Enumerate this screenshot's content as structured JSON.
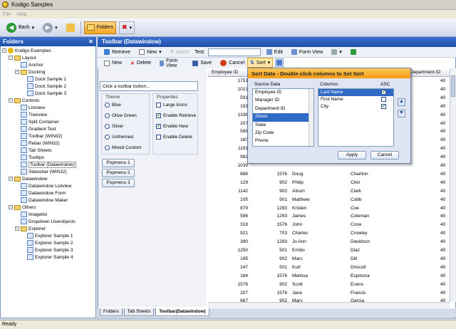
{
  "window": {
    "title": "Kodigo Samples"
  },
  "menu": [
    "File",
    "Help"
  ],
  "toolbar": {
    "back": "Back",
    "folders": "Folders"
  },
  "left": {
    "title": "Folders",
    "tree": [
      {
        "label": "Kodigo Examples",
        "depth": 0,
        "type": "root"
      },
      {
        "label": "Layout",
        "depth": 1,
        "type": "folder"
      },
      {
        "label": "Anchor",
        "depth": 2,
        "type": "doc"
      },
      {
        "label": "Docking",
        "depth": 2,
        "type": "folder"
      },
      {
        "label": "Dock Sample 1",
        "depth": 3,
        "type": "doc"
      },
      {
        "label": "Dock Sample 2",
        "depth": 3,
        "type": "doc"
      },
      {
        "label": "Dock Sample 3",
        "depth": 3,
        "type": "doc"
      },
      {
        "label": "Controls",
        "depth": 1,
        "type": "folder"
      },
      {
        "label": "Listview",
        "depth": 2,
        "type": "doc"
      },
      {
        "label": "Treeview",
        "depth": 2,
        "type": "doc"
      },
      {
        "label": "Split Container",
        "depth": 2,
        "type": "doc"
      },
      {
        "label": "Gradient Text",
        "depth": 2,
        "type": "doc"
      },
      {
        "label": "Toolbar (WIN32)",
        "depth": 2,
        "type": "doc"
      },
      {
        "label": "Rebar (WIN32)",
        "depth": 2,
        "type": "doc"
      },
      {
        "label": "Tab Sheets",
        "depth": 2,
        "type": "doc"
      },
      {
        "label": "Tooltips",
        "depth": 2,
        "type": "doc"
      },
      {
        "label": "Toolbar (Datawindow)",
        "depth": 2,
        "type": "doc",
        "selected": true
      },
      {
        "label": "Statusbar (WIN32)",
        "depth": 2,
        "type": "doc"
      },
      {
        "label": "Datawindow",
        "depth": 1,
        "type": "folder"
      },
      {
        "label": "Datawindow Listview",
        "depth": 2,
        "type": "doc"
      },
      {
        "label": "Datawindow Form",
        "depth": 2,
        "type": "doc"
      },
      {
        "label": "Datawindow Maker",
        "depth": 2,
        "type": "doc"
      },
      {
        "label": "Others",
        "depth": 1,
        "type": "folder"
      },
      {
        "label": "Imagelist",
        "depth": 2,
        "type": "doc"
      },
      {
        "label": "Dropdown Userobjects",
        "depth": 2,
        "type": "doc"
      },
      {
        "label": "Explorer",
        "depth": 2,
        "type": "folder"
      },
      {
        "label": "Explorer Sample 1",
        "depth": 3,
        "type": "doc"
      },
      {
        "label": "Explorer Sample 2",
        "depth": 3,
        "type": "doc"
      },
      {
        "label": "Explorer Sample 3",
        "depth": 3,
        "type": "doc"
      },
      {
        "label": "Explorer Sample 4",
        "depth": 3,
        "type": "doc"
      }
    ]
  },
  "right": {
    "title": "Toolbar (Datawindow)"
  },
  "tb1": {
    "retrieve": "Retrieve",
    "new": "New",
    "insert": "Insert",
    "test": "Test:",
    "edit": "Edit",
    "formview": "Form View"
  },
  "tb2": {
    "new": "New",
    "delete": "Delete",
    "formview": "Form View",
    "save": "Save",
    "cancel": "Cancel",
    "sort": "Sort"
  },
  "form": {
    "placeholder": "Click a toolbar button...",
    "theme": {
      "title": "Theme",
      "options": [
        "Blue",
        "Olive Green",
        "Silver",
        "Unthemed",
        "Mixed Custom"
      ]
    },
    "props": {
      "title": "Properties",
      "options": [
        {
          "label": "Large Icons",
          "checked": false
        },
        {
          "label": "Enable Retrieve",
          "checked": true
        },
        {
          "label": "Enable New",
          "checked": true
        },
        {
          "label": "Enable Delete",
          "checked": false
        }
      ]
    },
    "popmenus": [
      "Popmenu 1",
      "Popmenu 2",
      "Popmenu 3"
    ]
  },
  "grid": {
    "headers": [
      "Employee ID",
      "Department ID"
    ],
    "rows": [
      [
        "1751",
        "",
        "",
        "",
        "40"
      ],
      [
        "1013",
        "",
        "",
        "",
        "40"
      ],
      [
        "591",
        "",
        "",
        "",
        "40"
      ],
      [
        "191",
        "",
        "",
        "",
        "40"
      ],
      [
        "1336",
        "",
        "",
        "",
        "40"
      ],
      [
        "207",
        "",
        "",
        "",
        "40"
      ],
      [
        "568",
        "",
        "",
        "",
        "40"
      ],
      [
        "160",
        "",
        "",
        "",
        "40"
      ],
      [
        "1191",
        "",
        "",
        "",
        "40"
      ],
      [
        "992",
        "",
        "",
        "",
        "40"
      ],
      [
        "1039",
        "",
        "",
        "",
        "40"
      ],
      [
        "888",
        "1576",
        "Doug",
        "Charlton",
        "40"
      ],
      [
        "129",
        "902",
        "Philip",
        "Chin",
        "40"
      ],
      [
        "1142",
        "902",
        "Alison",
        "Clark",
        "40"
      ],
      [
        "105",
        "501",
        "Matthew",
        "Cobb",
        "40"
      ],
      [
        "879",
        "1293",
        "Kristen",
        "Coe",
        "40"
      ],
      [
        "586",
        "1293",
        "James",
        "Coleman",
        "40"
      ],
      [
        "318",
        "1576",
        "John",
        "Crow",
        "40"
      ],
      [
        "921",
        "703",
        "Charles",
        "Crowley",
        "40"
      ],
      [
        "390",
        "1293",
        "Jo Ann",
        "Davidson",
        "40"
      ],
      [
        "1250",
        "501",
        "Emilio",
        "Diaz",
        "40"
      ],
      [
        "195",
        "902",
        "Marc",
        "Dill",
        "40"
      ],
      [
        "247",
        "501",
        "Kurt",
        "Driscoll",
        "40"
      ],
      [
        "184",
        "1576",
        "Melissa",
        "Espinoza",
        "40"
      ],
      [
        "1576",
        "902",
        "Scott",
        "Evans",
        "40"
      ],
      [
        "207",
        "1576",
        "Jane",
        "Francis",
        "40"
      ],
      [
        "667",
        "902",
        "Mary",
        "Garcia",
        "40"
      ]
    ]
  },
  "tabs": [
    "Folders",
    "Tab Sheets",
    "Toolbar(Datawindow)"
  ],
  "status": "Ready",
  "sort": {
    "title": "Sort Data - Double-click columns to Set Sort",
    "source_label": "Source Data",
    "columns_label": "Columns",
    "asc_label": "ASC",
    "source": [
      "Employee ID",
      "Manager ID",
      "Department ID",
      "Street",
      "State",
      "Zip Code",
      "Phone"
    ],
    "columns": [
      {
        "name": "Last Name",
        "asc": true
      },
      {
        "name": "First Name",
        "asc": false
      },
      {
        "name": "City",
        "asc": true
      }
    ],
    "apply": "Apply",
    "cancel": "Cancel"
  }
}
